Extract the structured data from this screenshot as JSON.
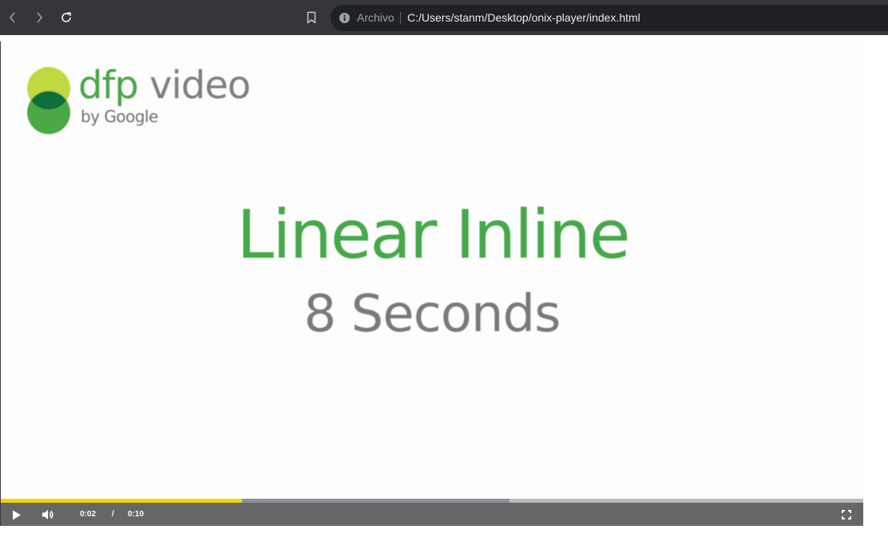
{
  "browser": {
    "scheme_label": "Archivo",
    "url": "C:/Users/stanm/Desktop/onix-player/index.html"
  },
  "ad": {
    "logo": {
      "brand_primary": "dfp",
      "brand_secondary": "video",
      "byline": "by Google",
      "colors": {
        "lime": "#c2d840",
        "green": "#4ca847",
        "dark_green": "#0d6e3a"
      }
    },
    "headline": "Linear Inline",
    "subline": "8 Seconds",
    "colors": {
      "headline": "#46a84a",
      "subline": "#7a7a7a"
    }
  },
  "player": {
    "current_time": "0:02",
    "separator": "/",
    "duration": "0:10",
    "played_fraction": 0.28,
    "buffered_fraction": 0.59,
    "colors": {
      "played": "#f2d600",
      "buffered": "#8a919a",
      "track": "#b8bcc1",
      "control_bar": "#666666"
    },
    "icons": {
      "play": "play-icon",
      "volume": "volume-icon",
      "fullscreen": "fullscreen-icon"
    }
  }
}
